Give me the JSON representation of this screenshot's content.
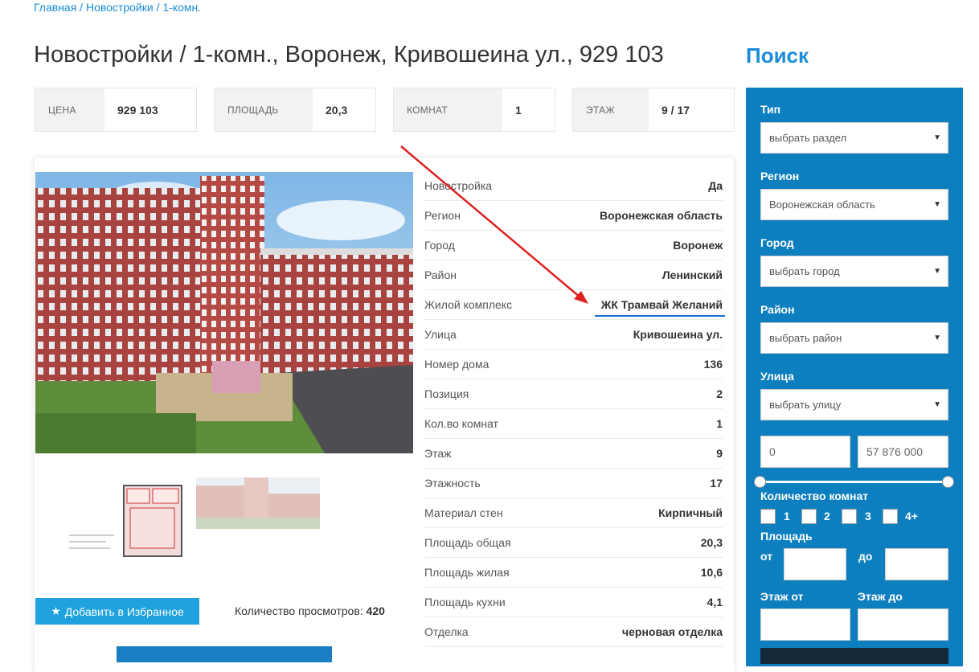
{
  "breadcrumb": {
    "home": "Главная",
    "sep1": " / ",
    "section": "Новостройки",
    "sep2": " / ",
    "current": "1-комн."
  },
  "page_title": "Новостройки / 1-комн., Воронеж, Кривошеина ул., 929 103",
  "stats": [
    {
      "label": "ЦЕНА",
      "value": "929 103"
    },
    {
      "label": "ПЛОЩАДЬ",
      "value": "20,3"
    },
    {
      "label": "КОМНАТ",
      "value": "1"
    },
    {
      "label": "ЭТАЖ",
      "value": "9 / 17"
    }
  ],
  "properties": [
    {
      "k": "Новостройка",
      "v": "Да"
    },
    {
      "k": "Регион",
      "v": "Воронежская область"
    },
    {
      "k": "Город",
      "v": "Воронеж"
    },
    {
      "k": "Район",
      "v": "Ленинский"
    },
    {
      "k": "Жилой комплекс",
      "v": "ЖК Трамвай Желаний"
    },
    {
      "k": "Улица",
      "v": "Кривошеина ул."
    },
    {
      "k": "Номер дома",
      "v": "136"
    },
    {
      "k": "Позиция",
      "v": "2"
    },
    {
      "k": "Кол.во комнат",
      "v": "1"
    },
    {
      "k": "Этаж",
      "v": "9"
    },
    {
      "k": "Этажность",
      "v": "17"
    },
    {
      "k": "Материал стен",
      "v": "Кирпичный"
    },
    {
      "k": "Площадь общая",
      "v": "20,3"
    },
    {
      "k": "Площадь жилая",
      "v": "10,6"
    },
    {
      "k": "Площадь кухни",
      "v": "4,1"
    },
    {
      "k": "Отделка",
      "v": "черновая отделка"
    }
  ],
  "favorite_button": "Добавить в Избранное",
  "views_label": "Количество просмотров:",
  "views_count": "420",
  "search": {
    "title": "Поиск",
    "type_label": "Тип",
    "type_value": "выбрать раздел",
    "region_label": "Регион",
    "region_value": "Воронежская область",
    "city_label": "Город",
    "city_value": "выбрать город",
    "district_label": "Район",
    "district_value": "выбрать район",
    "street_label": "Улица",
    "street_value": "выбрать улицу",
    "price_min": "0",
    "price_max": "57 876 000",
    "rooms_label": "Количество комнат",
    "rooms": [
      "1",
      "2",
      "3",
      "4+"
    ],
    "area_label": "Площадь",
    "area_from": "от",
    "area_to": "до",
    "floor_from": "Этаж от",
    "floor_to": "Этаж до"
  },
  "colors": {
    "accent": "#1a8cd8",
    "sidebar": "#0d7fbf",
    "button": "#1fa2de",
    "annotation": "#e02020"
  }
}
